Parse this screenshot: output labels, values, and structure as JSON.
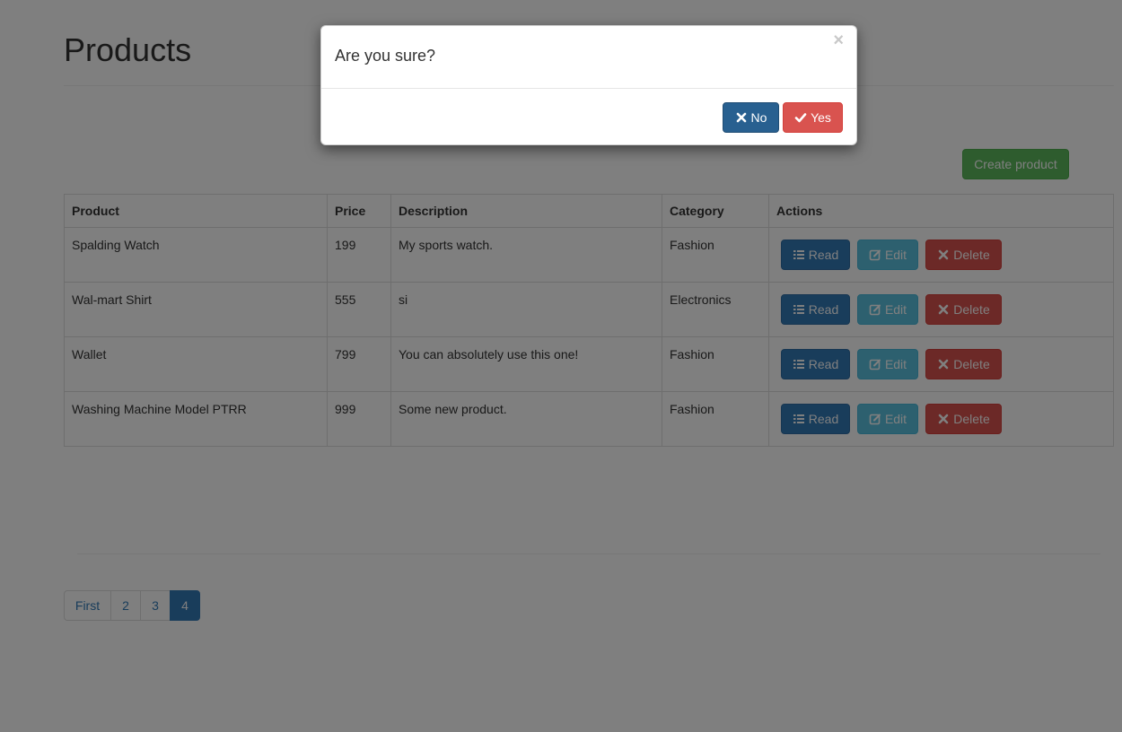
{
  "page": {
    "title": "Products",
    "create_button_label": "Create product"
  },
  "table": {
    "headers": [
      "Product",
      "Price",
      "Description",
      "Category",
      "Actions"
    ],
    "rows": [
      {
        "product": "Spalding Watch",
        "price": "199",
        "description": "My sports watch.",
        "category": "Fashion"
      },
      {
        "product": "Wal-mart Shirt",
        "price": "555",
        "description": "si",
        "category": "Electronics"
      },
      {
        "product": "Wallet",
        "price": "799",
        "description": "You can absolutely use this one!",
        "category": "Fashion"
      },
      {
        "product": "Washing Machine Model PTRR",
        "price": "999",
        "description": "Some new product.",
        "category": "Fashion"
      }
    ],
    "action_labels": {
      "read": "Read",
      "edit": "Edit",
      "delete": "Delete"
    }
  },
  "pagination": {
    "items": [
      "First",
      "2",
      "3",
      "4"
    ],
    "active": "4"
  },
  "modal": {
    "title": "Are you sure?",
    "close_glyph": "×",
    "no_label": "No",
    "yes_label": "Yes"
  },
  "icons": {
    "read": "list-icon",
    "edit": "edit-icon",
    "delete": "remove-icon",
    "no": "remove-icon",
    "yes": "check-icon"
  },
  "colors": {
    "primary": "#337ab7",
    "success": "#5cb85c",
    "info": "#5bc0de",
    "danger": "#d9534f",
    "backdrop": "#000000"
  }
}
